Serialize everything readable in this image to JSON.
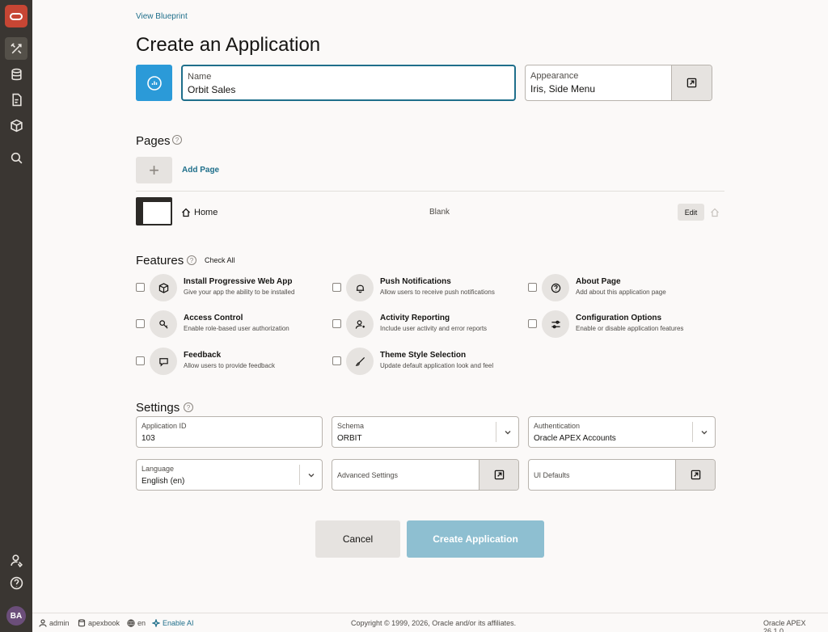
{
  "header": {
    "blueprint_link": "View Blueprint",
    "title": "Create an Application"
  },
  "app": {
    "name_label": "Name",
    "name_value": "Orbit Sales",
    "appearance_label": "Appearance",
    "appearance_value": "Iris, Side Menu"
  },
  "pages": {
    "title": "Pages",
    "help": "?",
    "add_plus": "+",
    "add_label": "Add Page",
    "items": [
      {
        "name": "Home",
        "type": "Blank",
        "edit_label": "Edit"
      }
    ]
  },
  "features": {
    "title": "Features",
    "help": "?",
    "check_all": "Check All",
    "items": [
      {
        "title": "Install Progressive Web App",
        "desc": "Give your app the ability to be installed",
        "icon": "cube-icon"
      },
      {
        "title": "Push Notifications",
        "desc": "Allow users to receive push notifications",
        "icon": "bell-icon"
      },
      {
        "title": "About Page",
        "desc": "Add about this application page",
        "icon": "question-icon"
      },
      {
        "title": "Access Control",
        "desc": "Enable role-based user authorization",
        "icon": "key-icon"
      },
      {
        "title": "Activity Reporting",
        "desc": "Include user activity and error reports",
        "icon": "user-activity-icon"
      },
      {
        "title": "Configuration Options",
        "desc": "Enable or disable application features",
        "icon": "sliders-icon"
      },
      {
        "title": "Feedback",
        "desc": "Allow users to provide feedback",
        "icon": "chat-icon"
      },
      {
        "title": "Theme Style Selection",
        "desc": "Update default application look and feel",
        "icon": "brush-icon"
      }
    ]
  },
  "settings": {
    "title": "Settings",
    "help": "?",
    "app_id_label": "Application ID",
    "app_id_value": "103",
    "schema_label": "Schema",
    "schema_value": "ORBIT",
    "auth_label": "Authentication",
    "auth_value": "Oracle APEX Accounts",
    "language_label": "Language",
    "language_value": "English (en)",
    "advanced_label": "Advanced Settings",
    "ui_defaults_label": "UI Defaults"
  },
  "actions": {
    "cancel": "Cancel",
    "create": "Create Application"
  },
  "sidebar": {
    "avatar_initials": "BA"
  },
  "footer": {
    "user": "admin",
    "workspace": "apexbook",
    "language": "en",
    "ai": "Enable AI",
    "copyright": "Copyright © 1999, 2026, Oracle and/or its affiliates.",
    "version": "Oracle APEX 26.1.0"
  },
  "colors": {
    "accent": "#1f6f8b",
    "app_icon": "#2b9ad8",
    "sidebar": "#3a3632",
    "create_button": "#8ebfd1",
    "oracle_red": "#c74634"
  }
}
